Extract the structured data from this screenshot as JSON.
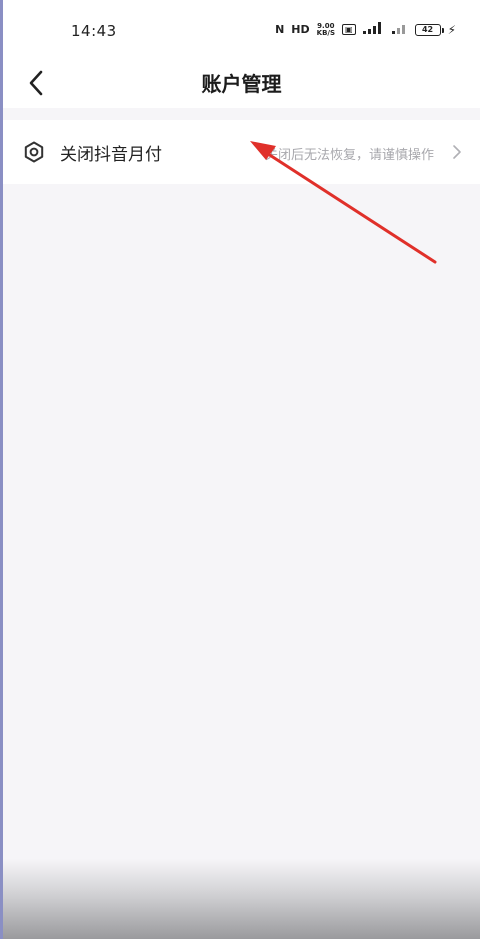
{
  "status_bar": {
    "time": "14:43",
    "icons": [
      "nfc-icon",
      "hd-icon",
      "speed-icon",
      "sim-icon",
      "signal-icon",
      "wifi-signal-icon",
      "battery-icon",
      "charging-icon"
    ],
    "speed_text": "9.00\nKB/S",
    "battery_level": "42"
  },
  "nav": {
    "title": "账户管理"
  },
  "row": {
    "label": "关闭抖音月付",
    "description": "关闭后无法恢复，请谨慎操作"
  },
  "colors": {
    "background": "#f6f5f8",
    "annotation_arrow": "#e0302a",
    "text_primary": "#222222",
    "text_secondary": "#a8a8ad"
  }
}
